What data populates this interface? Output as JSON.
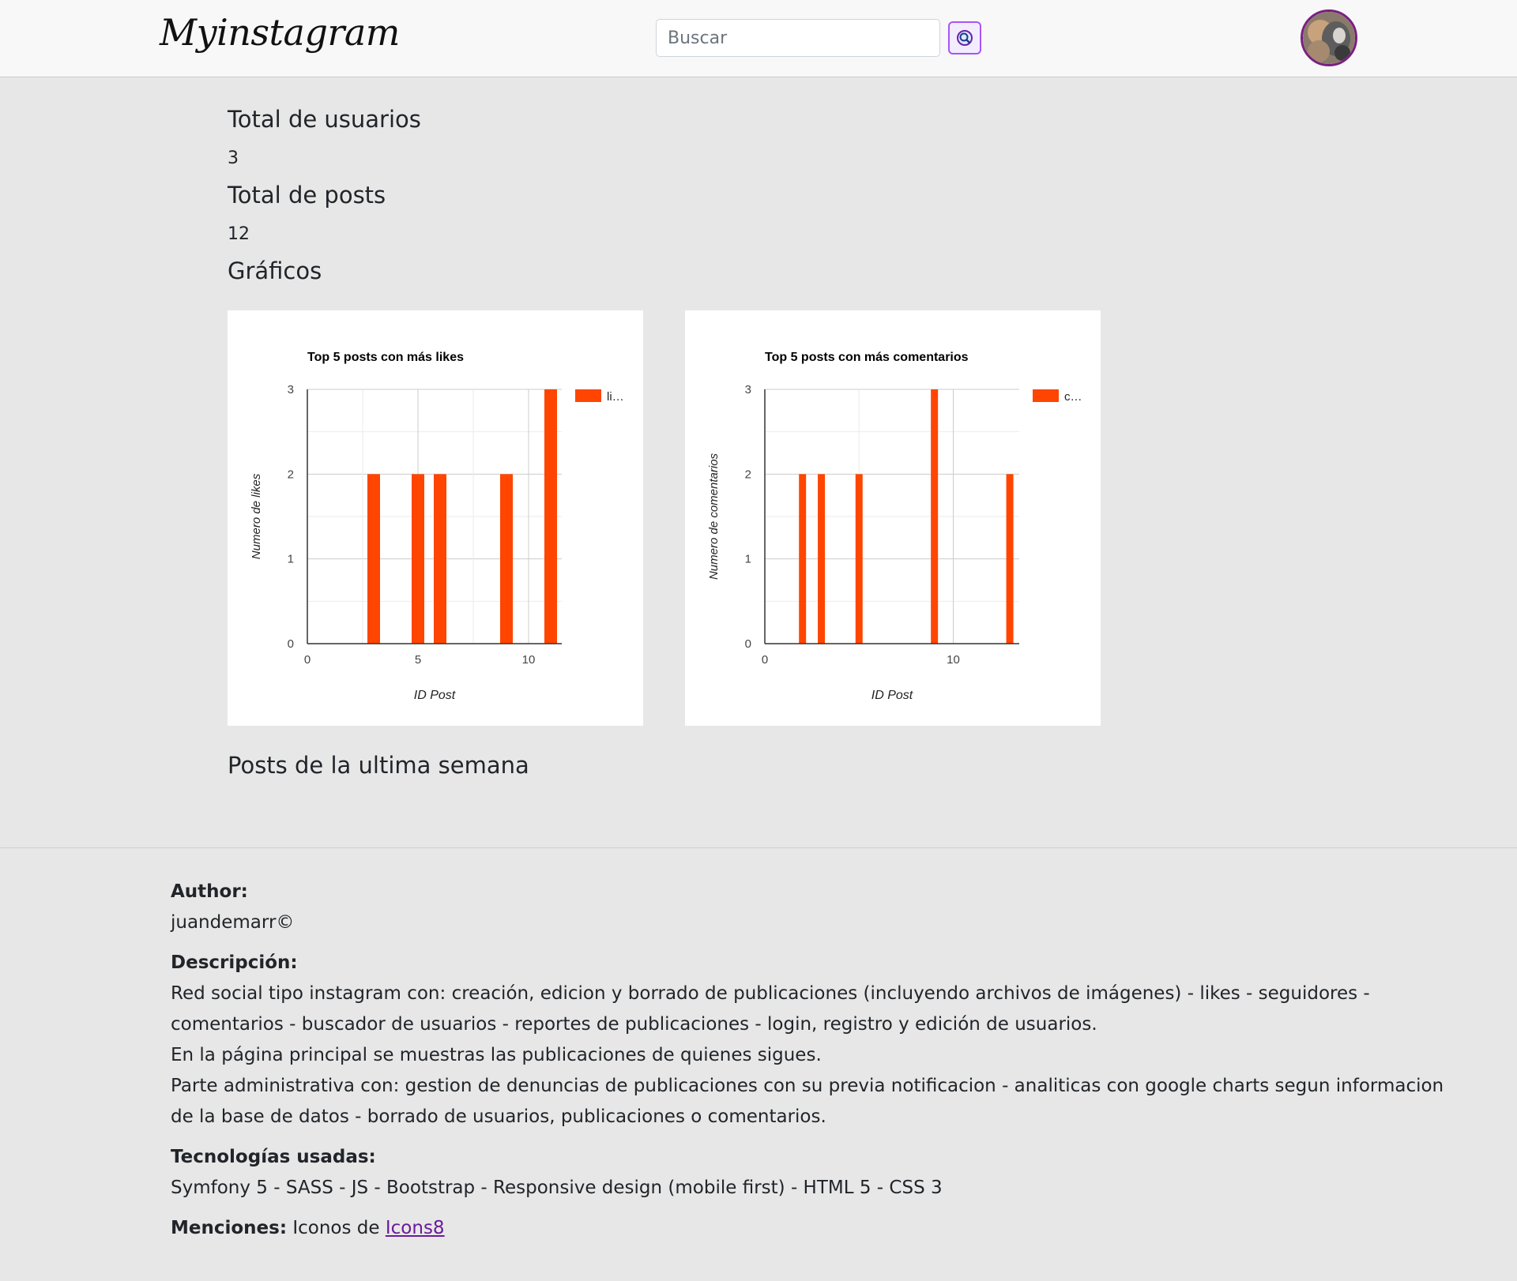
{
  "header": {
    "logo": "Myinstagram",
    "search_placeholder": "Buscar",
    "search_icon": "magnifier-icon",
    "avatar_icon": "user-avatar"
  },
  "stats": {
    "users_title": "Total de usuarios",
    "users_value": "3",
    "posts_title": "Total de posts",
    "posts_value": "12",
    "charts_title": "Gráficos",
    "week_title": "Posts de la ultima semana"
  },
  "chart_data": [
    {
      "type": "bar",
      "title": "Top 5 posts con más likes",
      "xlabel": "ID Post",
      "ylabel": "Numero de likes",
      "legend": "li…",
      "legend_position": "right",
      "color": "#ff4500",
      "x": [
        3,
        5,
        6,
        9,
        11
      ],
      "values": [
        2,
        2,
        2,
        2,
        3
      ],
      "xlim": [
        0,
        11.5
      ],
      "ylim": [
        0,
        3
      ],
      "xticks": [
        0,
        5,
        10
      ],
      "yticks": [
        0,
        1,
        2,
        3
      ]
    },
    {
      "type": "bar",
      "title": "Top 5 posts con más comentarios",
      "xlabel": "ID Post",
      "ylabel": "Numero de comentarios",
      "legend": "c…",
      "legend_position": "right",
      "color": "#ff4500",
      "x": [
        2,
        3,
        5,
        9,
        13
      ],
      "values": [
        2,
        2,
        2,
        3,
        2
      ],
      "xlim": [
        0,
        13.5
      ],
      "ylim": [
        0,
        3
      ],
      "xticks": [
        0,
        10
      ],
      "yticks": [
        0,
        1,
        2,
        3
      ]
    }
  ],
  "footer": {
    "author_label": "Author:",
    "author_value": "juandemarr©",
    "desc_label": "Descripción:",
    "desc_line1": "Red social tipo instagram con: creación, edicion y borrado de publicaciones (incluyendo archivos de imágenes) - likes - seguidores -",
    "desc_line2": "comentarios - buscador de usuarios - reportes de publicaciones - login, registro y edición de usuarios.",
    "desc_line3": "En la página principal se muestras las publicaciones de quienes sigues.",
    "desc_line4": "Parte administrativa con: gestion de denuncias de publicaciones con su previa notificacion - analiticas con google charts segun informacion",
    "desc_line5": "de la base de datos - borrado de usuarios, publicaciones o comentarios.",
    "tech_label": "Tecnologías usadas:",
    "tech_value": "Symfony 5 - SASS - JS - Bootstrap - Responsive design (mobile first) - HTML 5 - CSS 3",
    "mentions_label": "Menciones:",
    "mentions_text": "Iconos de",
    "mentions_link": "Icons8"
  }
}
